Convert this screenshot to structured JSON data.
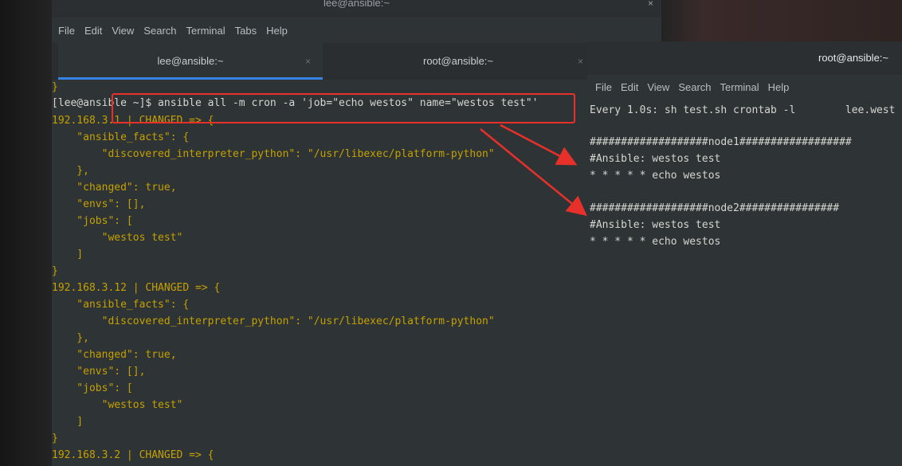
{
  "left_window": {
    "title": "lee@ansible:~",
    "close_glyph": "×",
    "menu": [
      "File",
      "Edit",
      "View",
      "Search",
      "Terminal",
      "Tabs",
      "Help"
    ],
    "tabs": [
      {
        "label": "lee@ansible:~",
        "close": "×"
      },
      {
        "label": "root@ansible:~",
        "close": "×"
      }
    ],
    "terminal_lines": [
      "}",
      "[lee@ansible ~]$ ansible all -m cron -a 'job=\"echo westos\" name=\"westos test\"'",
      "192.168.3.1 | CHANGED => {",
      "    \"ansible_facts\": {",
      "        \"discovered_interpreter_python\": \"/usr/libexec/platform-python\"",
      "    },",
      "    \"changed\": true,",
      "    \"envs\": [],",
      "    \"jobs\": [",
      "        \"westos test\"",
      "    ]",
      "}",
      "192.168.3.12 | CHANGED => {",
      "    \"ansible_facts\": {",
      "        \"discovered_interpreter_python\": \"/usr/libexec/platform-python\"",
      "    },",
      "    \"changed\": true,",
      "    \"envs\": [],",
      "    \"jobs\": [",
      "        \"westos test\"",
      "    ]",
      "}",
      "192.168.3.2 | CHANGED => {"
    ]
  },
  "right_window": {
    "title": "root@ansible:~",
    "menu": [
      "File",
      "Edit",
      "View",
      "Search",
      "Terminal",
      "Help"
    ],
    "terminal_lines": [
      "Every 1.0s: sh test.sh crontab -l        lee.west",
      "",
      "###################node1##################",
      "#Ansible: westos test",
      "* * * * * echo westos",
      "",
      "###################node2################",
      "#Ansible: westos test",
      "* * * * * echo westos"
    ]
  },
  "colors": {
    "highlight_box": "#e8302a",
    "tab_underline": "#3584e4",
    "terminal_bg": "#2e3436",
    "output_text": "#c4a000"
  }
}
